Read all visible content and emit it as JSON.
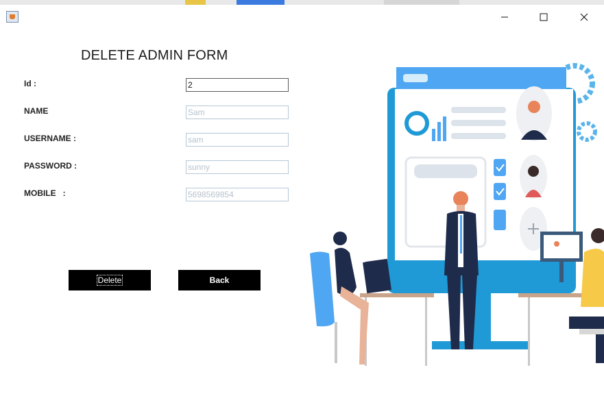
{
  "window": {
    "app_icon": "java-cup-icon",
    "minimize_icon": "minimize-icon",
    "maximize_icon": "maximize-icon",
    "close_icon": "close-icon"
  },
  "form": {
    "title": "DELETE ADMIN FORM",
    "fields": [
      {
        "label": "Id :",
        "value": "2"
      },
      {
        "label": "NAME",
        "value": "Sam"
      },
      {
        "label": "USERNAME :",
        "value": "sam"
      },
      {
        "label": "PASSWORD :",
        "value": "sunny"
      },
      {
        "label": "MOBILE   :",
        "value": "5698569854"
      }
    ],
    "delete_label": "Delete",
    "back_label": "Back"
  },
  "colors": {
    "button_bg": "#000000",
    "accent_blue": "#1f9ad6",
    "dark_navy": "#1f2b4a",
    "skin_orange": "#e8835a"
  }
}
